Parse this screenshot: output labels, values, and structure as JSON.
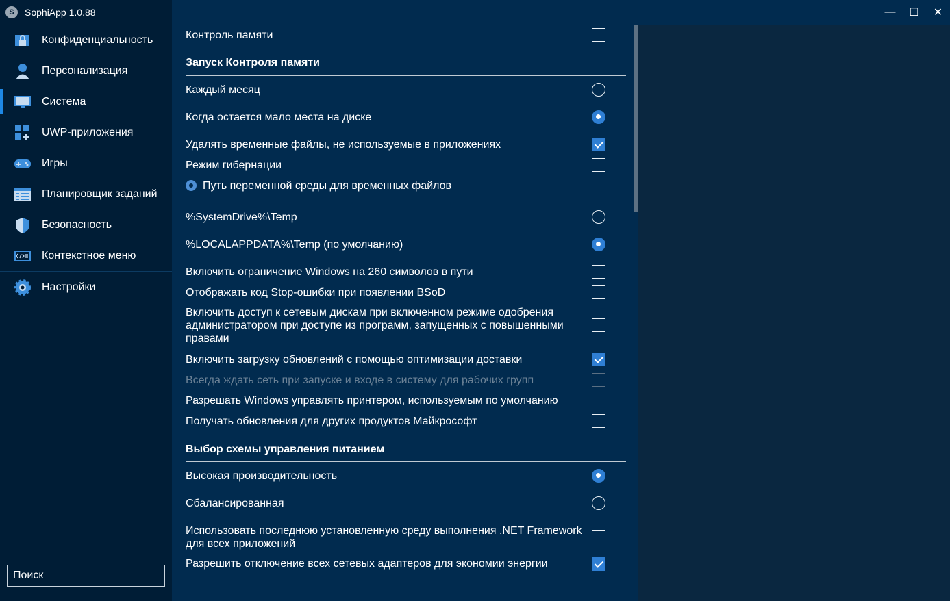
{
  "app": {
    "title": "SophiApp 1.0.88",
    "logo_glyph": "S"
  },
  "window_controls": {
    "minimize": "—",
    "maximize": "☐",
    "close": "✕"
  },
  "sidebar": {
    "items": [
      {
        "label": "Конфиденциальность",
        "icon": "privacy-icon"
      },
      {
        "label": "Персонализация",
        "icon": "personalization-icon"
      },
      {
        "label": "Система",
        "icon": "system-icon",
        "active": true
      },
      {
        "label": "UWP-приложения",
        "icon": "uwp-apps-icon"
      },
      {
        "label": "Игры",
        "icon": "gamepad-icon"
      },
      {
        "label": "Планировщик заданий",
        "icon": "task-scheduler-icon"
      },
      {
        "label": "Безопасность",
        "icon": "shield-icon"
      },
      {
        "label": "Контекстное меню",
        "icon": "context-menu-icon"
      },
      {
        "label": "Настройки",
        "icon": "gear-icon"
      }
    ],
    "search_placeholder": "Поиск"
  },
  "main": {
    "rows": [
      {
        "label": "Контроль памяти",
        "control": "checkbox",
        "checked": false
      },
      {
        "label": "Запуск Контроля памяти",
        "header": true
      },
      {
        "label": "Каждый месяц",
        "control": "radio",
        "checked": false
      },
      {
        "label": "Когда остается мало места на диске",
        "control": "radio",
        "checked": true
      },
      {
        "label": "Удалять временные файлы, не используемые в приложениях",
        "control": "checkbox",
        "checked": true
      },
      {
        "label": "Режим гибернации",
        "control": "checkbox",
        "checked": false
      },
      {
        "label": "Путь переменной среды для временных файлов",
        "icon": "settings-gear-icon"
      },
      {
        "label": "%SystemDrive%\\Temp",
        "control": "radio",
        "checked": false
      },
      {
        "label": "%LOCALAPPDATA%\\Temp (по умолчанию)",
        "control": "radio",
        "checked": true
      },
      {
        "label": "Включить ограничение Windows на 260 символов в пути",
        "control": "checkbox",
        "checked": false
      },
      {
        "label": "Отображать код Stop-ошибки при появлении BSoD",
        "control": "checkbox",
        "checked": false
      },
      {
        "label": "Включить доступ к сетевым дискам при включенном режиме одобрения администратором при доступе из программ, запущенных с повышенными правами",
        "control": "checkbox",
        "checked": false
      },
      {
        "label": "Включить загрузку обновлений с помощью оптимизации доставки",
        "control": "checkbox",
        "checked": true
      },
      {
        "label": "Всегда ждать сеть при запуске и входе в систему для рабочих групп",
        "control": "checkbox",
        "checked": false,
        "disabled": true
      },
      {
        "label": "Разрешать Windows управлять принтером, используемым по умолчанию",
        "control": "checkbox",
        "checked": false
      },
      {
        "label": "Получать обновления для других продуктов Майкрософт",
        "control": "checkbox",
        "checked": false
      },
      {
        "label": "Выбор схемы управления питанием",
        "header": true
      },
      {
        "label": "Высокая производительность",
        "control": "radio",
        "checked": true
      },
      {
        "label": "Сбалансированная",
        "control": "radio",
        "checked": false
      },
      {
        "label": "Использовать последнюю установленную среду выполнения .NET Framework для всех приложений",
        "control": "checkbox",
        "checked": false
      },
      {
        "label": "Разрешить отключение всех сетевых адаптеров для экономии энергии",
        "control": "checkbox",
        "checked": true
      }
    ]
  },
  "colors": {
    "accent": "#2f7fd4",
    "sidebar_bg": "#001d36",
    "main_bg": "#012b4f"
  }
}
